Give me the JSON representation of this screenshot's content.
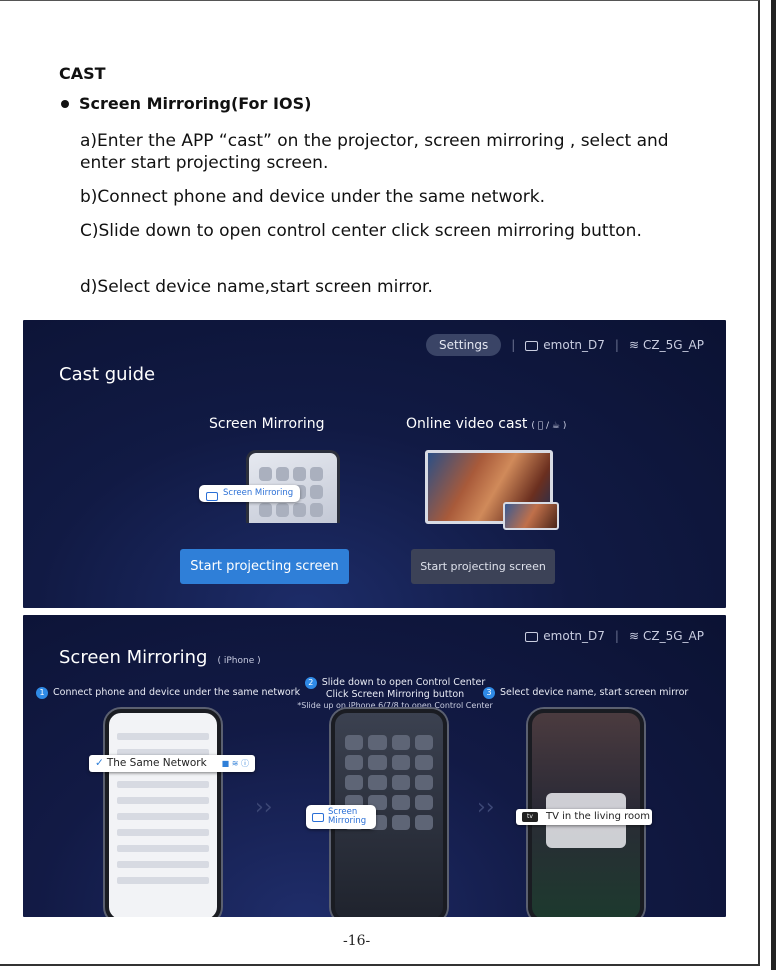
{
  "heading": "CAST",
  "bullet": "Screen Mirroring(For IOS)",
  "steps": {
    "a": "a)Enter the APP “cast” on the projector, screen mirroring , select and enter start projecting screen.",
    "b": "b)Connect phone and device under the same network.",
    "c": "C)Slide down to open control center click screen mirroring button.",
    "d": "d)Select device name,start screen mirror."
  },
  "shot1": {
    "settings": "Settings",
    "device": "emotn_D7",
    "wifi": "CZ_5G_AP",
    "title": "Cast guide",
    "col1_title": "Screen Mirroring",
    "col2_title": "Online video cast",
    "col2_platforms": "(  / ☕ )",
    "mirror_badge": "Screen Mirroring",
    "btn_primary": "Start projecting screen",
    "btn_secondary": "Start projecting screen"
  },
  "shot2": {
    "device": "emotn_D7",
    "wifi": "CZ_5G_AP",
    "title": "Screen Mirroring",
    "title_note": "( iPhone )",
    "step1_num": "1",
    "step1": "Connect phone and device under the same network",
    "step2_num": "2",
    "step2_line1": "Slide down to open Control Center",
    "step2_line2": "Click Screen Mirroring button",
    "step2_line3": "*Slide up on iPhone 6/7/8 to open Control Center",
    "step3_num": "3",
    "step3": "Select device name, start screen mirror",
    "callout_network": "The Same Network",
    "callout_mirroring": "Screen Mirroring",
    "callout_tv": "TV in the living room",
    "tv_badge": "tv"
  },
  "page_number": "-16-",
  "colors": {
    "accent": "#2f7fd8",
    "screen_bg": "#111a44"
  },
  "icons": [
    "monitor-icon",
    "wifi-icon",
    "screen-mirroring-icon",
    "chevron-right-icon",
    "apple-tv-icon",
    "check-icon"
  ]
}
